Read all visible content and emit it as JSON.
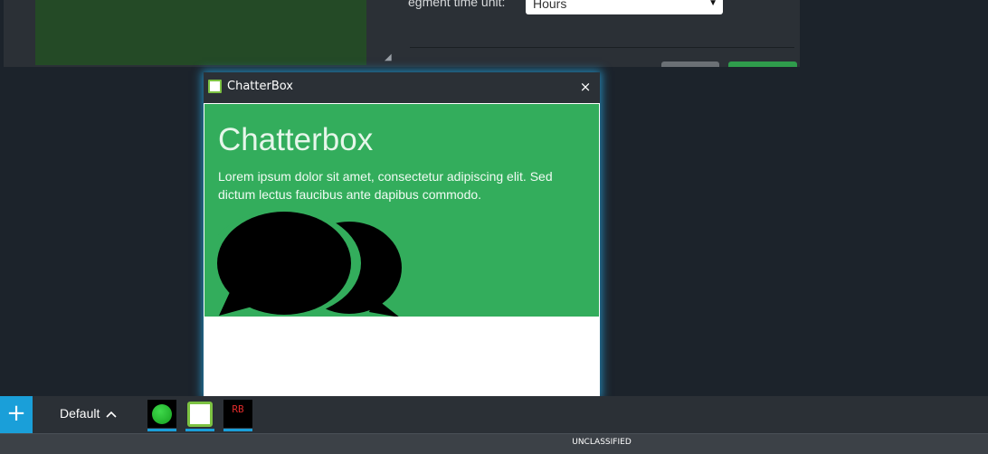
{
  "background_window": {
    "segment_label": "egment time unit:",
    "segment_select_value": "Hours"
  },
  "chat_window": {
    "title": "ChatterBox",
    "close_glyph": "×",
    "hero_title": "Chatterbox",
    "hero_text": "Lorem ipsum dolor sit amet, consectetur adipiscing elit. Sed dictum lectus faucibus ante dapibus commodo.",
    "accent_color": "#33ad5c"
  },
  "taskbar": {
    "add_glyph": "+",
    "workspace_label": "Default",
    "workspace_caret": "^",
    "apps": [
      {
        "icon": "green-dot-icon"
      },
      {
        "icon": "chat-bubble-icon"
      },
      {
        "label": "RB"
      }
    ]
  },
  "classification": {
    "label": "UNCLASSIFIED"
  }
}
